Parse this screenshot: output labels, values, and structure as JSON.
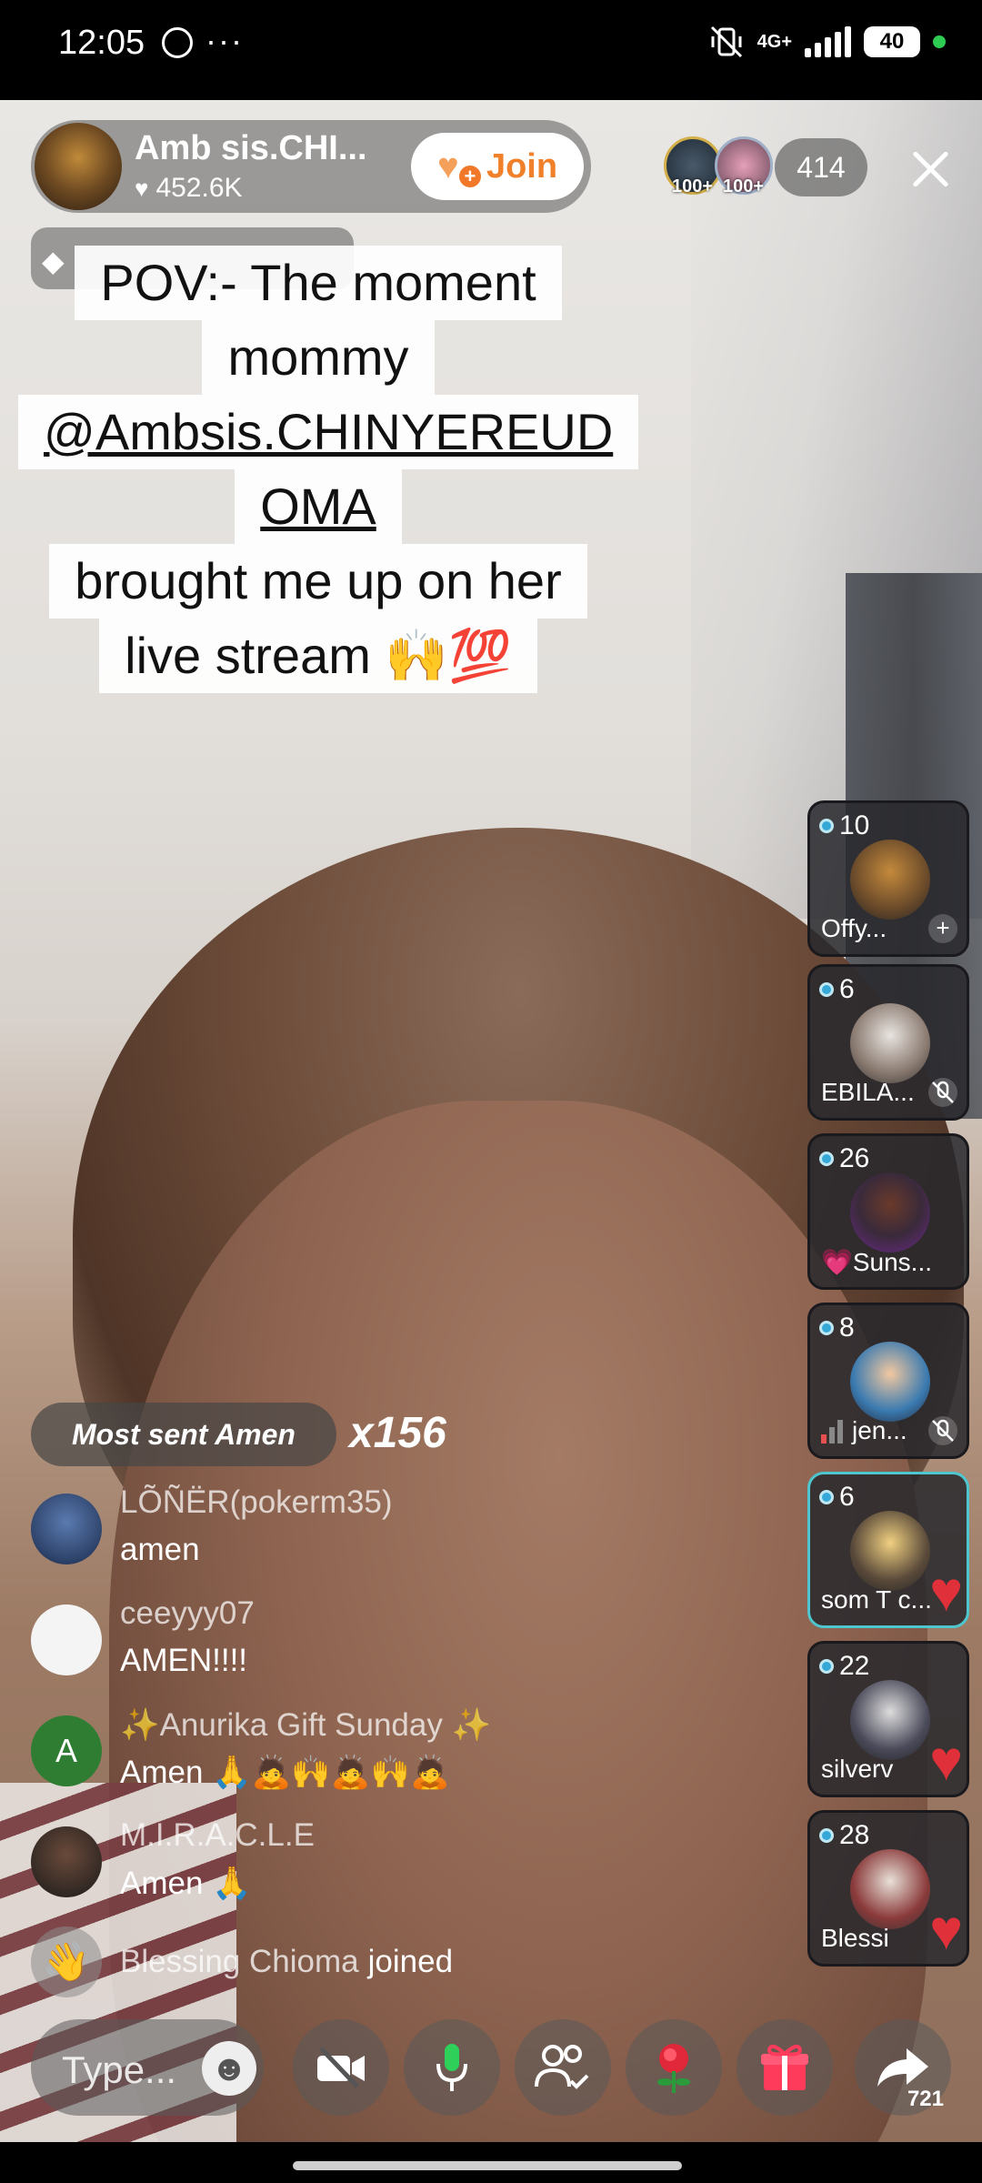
{
  "status_bar": {
    "time": "12:05",
    "notif_dots": "···",
    "network": "4G+",
    "battery": "40"
  },
  "host": {
    "name": "Amb sis.CHI...",
    "likes": "452.6K",
    "join_label": "Join"
  },
  "viewers": {
    "badge_1": "100+",
    "badge_2": "100+",
    "count": "414"
  },
  "caption": {
    "line1": "POV:- The moment",
    "line2": "mommy",
    "line3": "@Ambsis.CHINYEREUD",
    "line4": "OMA",
    "line5": "brought me up on her",
    "line6": "live stream 🙌💯"
  },
  "guests": [
    {
      "count": "10",
      "name": "Offy...",
      "action": "+"
    },
    {
      "count": "6",
      "name": "EBILA...",
      "action": "mic-muted"
    },
    {
      "count": "26",
      "name": "💗Suns..."
    },
    {
      "count": "8",
      "name": "jen...",
      "action": "mic-muted"
    },
    {
      "count": "6",
      "name": "som T c..."
    },
    {
      "count": "22",
      "name": "silverv"
    },
    {
      "count": "28",
      "name": "Blessi"
    }
  ],
  "gift_banner": {
    "label": "Most sent Amen",
    "multiplier": "x156"
  },
  "chat": [
    {
      "user": "LÕÑËR(pokerm35)",
      "text": "amen"
    },
    {
      "user": "ceeyyy07",
      "text": "AMEN!!!!"
    },
    {
      "user": "✨Anurika Gift Sunday ✨",
      "text": "Amen 🙏🙇🙌🙇🙌🙇",
      "avatar_letter": "A"
    },
    {
      "user": "M.I.R.A.C.L.E",
      "text": "Amen 🙏"
    }
  ],
  "joined": {
    "name": "Blessing Chioma",
    "suffix": "joined"
  },
  "bottom_bar": {
    "input_placeholder": "Type...",
    "share_count": "721"
  },
  "colors": {
    "join_text": "#f0802a",
    "active_tile_border": "#4ec6d0",
    "heart": "#e0303a",
    "gift": "#ff3b5c"
  }
}
